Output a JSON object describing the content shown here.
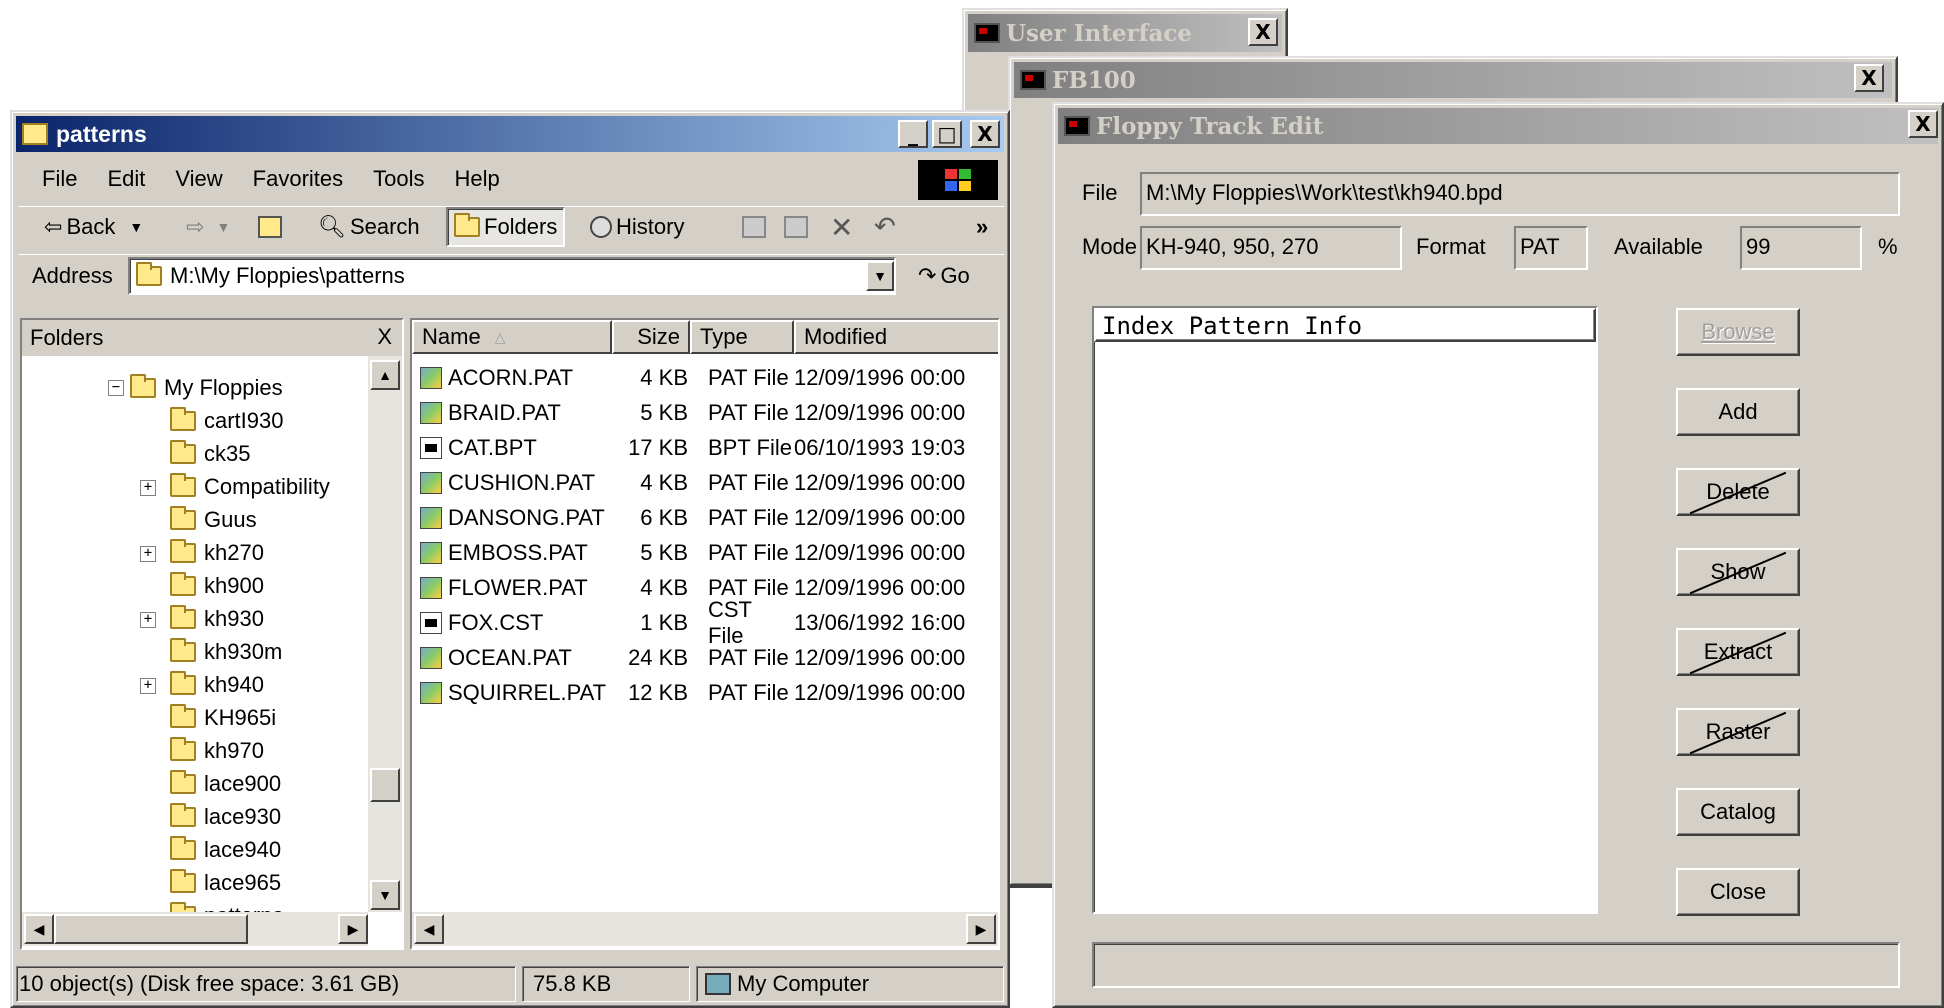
{
  "user_interface": {
    "title": "User Interface",
    "close": "X"
  },
  "fb100": {
    "title": "FB100",
    "close": "X"
  },
  "track_edit": {
    "title": "Floppy Track Edit",
    "close": "X",
    "file_label": "File",
    "file_value": "M:\\My Floppies\\Work\\test\\kh940.bpd",
    "mode_label": "Mode",
    "mode_value": "KH-940, 950, 270",
    "format_label": "Format",
    "format_value": "PAT",
    "available_label": "Available",
    "available_value": "99",
    "percent": "%",
    "list_header": "Index Pattern Info",
    "buttons": {
      "browse": "Browse",
      "add": "Add",
      "delete": "Delete",
      "show": "Show",
      "extract": "Extract",
      "raster": "Raster",
      "catalog": "Catalog",
      "close": "Close"
    }
  },
  "explorer": {
    "title": "patterns",
    "title_buttons": {
      "minimize": "_",
      "maximize": "□",
      "close": "X"
    },
    "menu": [
      "File",
      "Edit",
      "View",
      "Favorites",
      "Tools",
      "Help"
    ],
    "toolbar": {
      "back": "Back",
      "search": "Search",
      "folders": "Folders",
      "history": "History",
      "more": "»"
    },
    "address_label": "Address",
    "address_value": "M:\\My Floppies\\patterns",
    "go": "Go",
    "folders_pane": {
      "title": "Folders",
      "close": "X",
      "root": "My Floppies",
      "items": [
        "cartI930",
        "ck35",
        "Compatibility",
        "Guus",
        "kh270",
        "kh900",
        "kh930",
        "kh930m",
        "kh940",
        "KH965i",
        "kh970",
        "lace900",
        "lace930",
        "lace940",
        "lace965",
        "patterns"
      ]
    },
    "columns": [
      "Name",
      "Size",
      "Type",
      "Modified"
    ],
    "files": [
      {
        "name": "ACORN.PAT",
        "size": "4 KB",
        "type": "PAT File",
        "modified": "12/09/1996 00:00"
      },
      {
        "name": "BRAID.PAT",
        "size": "5 KB",
        "type": "PAT File",
        "modified": "12/09/1996 00:00"
      },
      {
        "name": "CAT.BPT",
        "size": "17 KB",
        "type": "BPT File",
        "modified": "06/10/1993 19:03"
      },
      {
        "name": "CUSHION.PAT",
        "size": "4 KB",
        "type": "PAT File",
        "modified": "12/09/1996 00:00"
      },
      {
        "name": "DANSONG.PAT",
        "size": "6 KB",
        "type": "PAT File",
        "modified": "12/09/1996 00:00"
      },
      {
        "name": "EMBOSS.PAT",
        "size": "5 KB",
        "type": "PAT File",
        "modified": "12/09/1996 00:00"
      },
      {
        "name": "FLOWER.PAT",
        "size": "4 KB",
        "type": "PAT File",
        "modified": "12/09/1996 00:00"
      },
      {
        "name": "FOX.CST",
        "size": "1 KB",
        "type": "CST File",
        "modified": "13/06/1992 16:00"
      },
      {
        "name": "OCEAN.PAT",
        "size": "24 KB",
        "type": "PAT File",
        "modified": "12/09/1996 00:00"
      },
      {
        "name": "SQUIRREL.PAT",
        "size": "12 KB",
        "type": "PAT File",
        "modified": "12/09/1996 00:00"
      }
    ],
    "status": {
      "objects": "10 object(s) (Disk free space: 3.61 GB)",
      "size": "75.8 KB",
      "location": "My Computer"
    }
  }
}
